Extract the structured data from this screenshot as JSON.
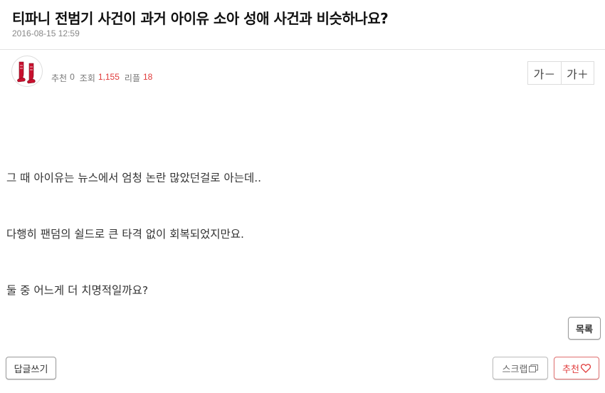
{
  "post": {
    "title": "티파니 전범기 사건이 과거 아이유 소아 성애 사건과 비슷하나요?",
    "date": "2016-08-15 12:59"
  },
  "meta": {
    "recommend_label": "추천",
    "recommend_count": "0",
    "views_label": "조회",
    "views_count": "1,155",
    "replies_label": "리플",
    "replies_count": "18"
  },
  "font_controls": {
    "decrease": "가－",
    "increase": "가＋"
  },
  "content": {
    "lines": [
      "그 때 아이유는 뉴스에서 엄청 논란 많았던걸로 아는데..",
      "다행히 팬덤의 쉴드로 큰 타격 없이 회복되었지만요.",
      "둘 중 어느게 더 치명적일까요?"
    ]
  },
  "buttons": {
    "list": "목록",
    "reply": "답글쓰기",
    "scrap": "스크랩",
    "recommend": "추천"
  },
  "icons": {
    "avatar": "red-sox-logo",
    "scrap": "scrap-copy-icon",
    "recommend": "heart-icon"
  },
  "colors": {
    "accent": "#e03a3a",
    "logo_red": "#c8102e"
  }
}
